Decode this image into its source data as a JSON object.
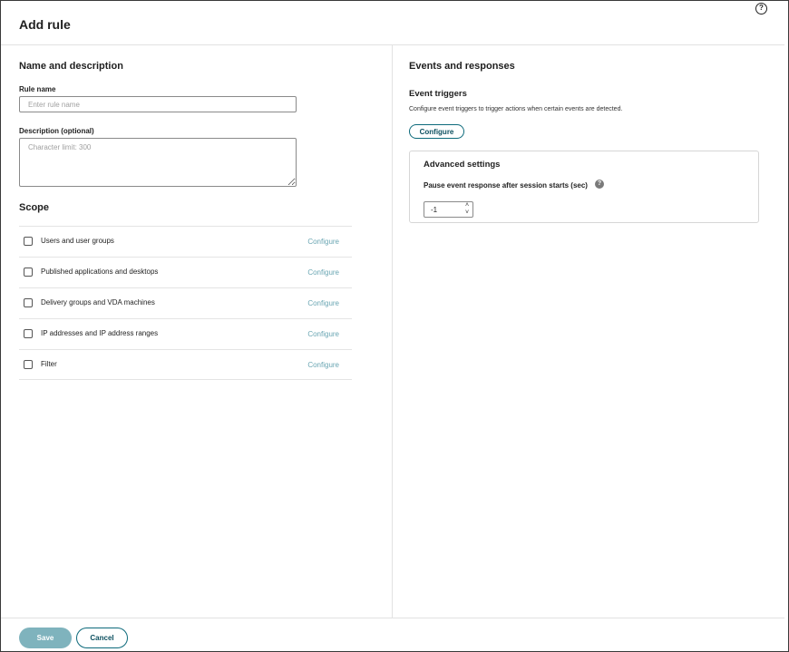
{
  "header": {
    "title": "Add rule",
    "help_icon": "help-circle-icon",
    "help_glyph": "?"
  },
  "name_section": {
    "title": "Name and description",
    "rule_name_label": "Rule name",
    "rule_name_value": "",
    "rule_name_placeholder": "Enter rule name",
    "description_label": "Description (optional)",
    "description_value": "",
    "description_placeholder": "Character limit: 300"
  },
  "scope": {
    "title": "Scope",
    "items": [
      {
        "label": "Users and user groups",
        "checked": false,
        "action": "Configure"
      },
      {
        "label": "Published applications and desktops",
        "checked": false,
        "action": "Configure"
      },
      {
        "label": "Delivery groups and VDA machines",
        "checked": false,
        "action": "Configure"
      },
      {
        "label": "IP addresses and IP address ranges",
        "checked": false,
        "action": "Configure"
      },
      {
        "label": "Filter",
        "checked": false,
        "action": "Configure"
      }
    ]
  },
  "events": {
    "title": "Events and responses",
    "triggers_title": "Event triggers",
    "triggers_help": "Configure event triggers to trigger actions when certain events are detected.",
    "configure_label": "Configure",
    "advanced": {
      "title": "Advanced settings",
      "pause_label": "Pause event response after session starts (sec)",
      "pause_value": "-1",
      "info_icon": "info-icon",
      "info_glyph": "?"
    }
  },
  "footer": {
    "save_label": "Save",
    "cancel_label": "Cancel"
  },
  "colors": {
    "accent": "#0d6a7b",
    "link": "#6aa6b3",
    "save_disabled": "#7fb3bd"
  }
}
